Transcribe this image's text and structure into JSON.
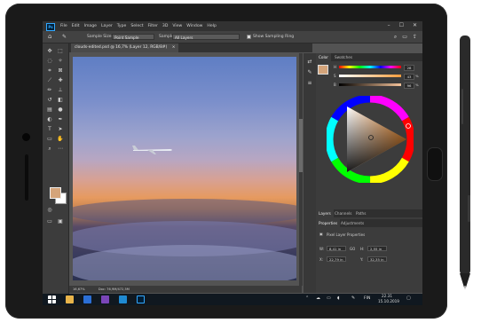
{
  "app": {
    "logo_text": "Ps",
    "menu": [
      "File",
      "Edit",
      "Image",
      "Layer",
      "Type",
      "Select",
      "Filter",
      "3D",
      "View",
      "Window",
      "Help"
    ],
    "window_controls": [
      "–",
      "☐",
      "✕"
    ]
  },
  "options_bar": {
    "sample_size_label": "Sample Size:",
    "sample_size_value": "Point Sample",
    "sample_label": "Sample:",
    "sample_value": "All Layers",
    "show_ring_label": "Show Sampling Ring"
  },
  "document": {
    "tab_label": "clouds-edited.psd @ 16,7% (Layer 12, RGB/8#)",
    "tab_close": "×",
    "status_zoom": "16,67%",
    "status_doc": "Doc: 76,9M/472,5M"
  },
  "panels": {
    "color_tabs": [
      "Color",
      "Swatches"
    ],
    "color_values": {
      "h": "28",
      "s": "43",
      "b": "96"
    },
    "color_labels": {
      "h": "H",
      "s": "S",
      "b": "B"
    },
    "pct": "%",
    "layer_tabs": [
      "Layers",
      "Channels",
      "Paths"
    ],
    "props_tabs": [
      "Properties",
      "Adjustments"
    ],
    "props_title": "Pixel Layer Properties",
    "w_label": "W:",
    "w_value": "8,41 in",
    "h_label": "H:",
    "h_value": "2,55 in",
    "go_label": "GO",
    "x_label": "X:",
    "x_value": "22,79 in",
    "y_label": "Y:",
    "y_value": "32,35 in",
    "fg_color": "#d4a47a"
  },
  "taskbar": {
    "lang": "FIN",
    "time": "22.31",
    "date": "15.10.2019"
  }
}
